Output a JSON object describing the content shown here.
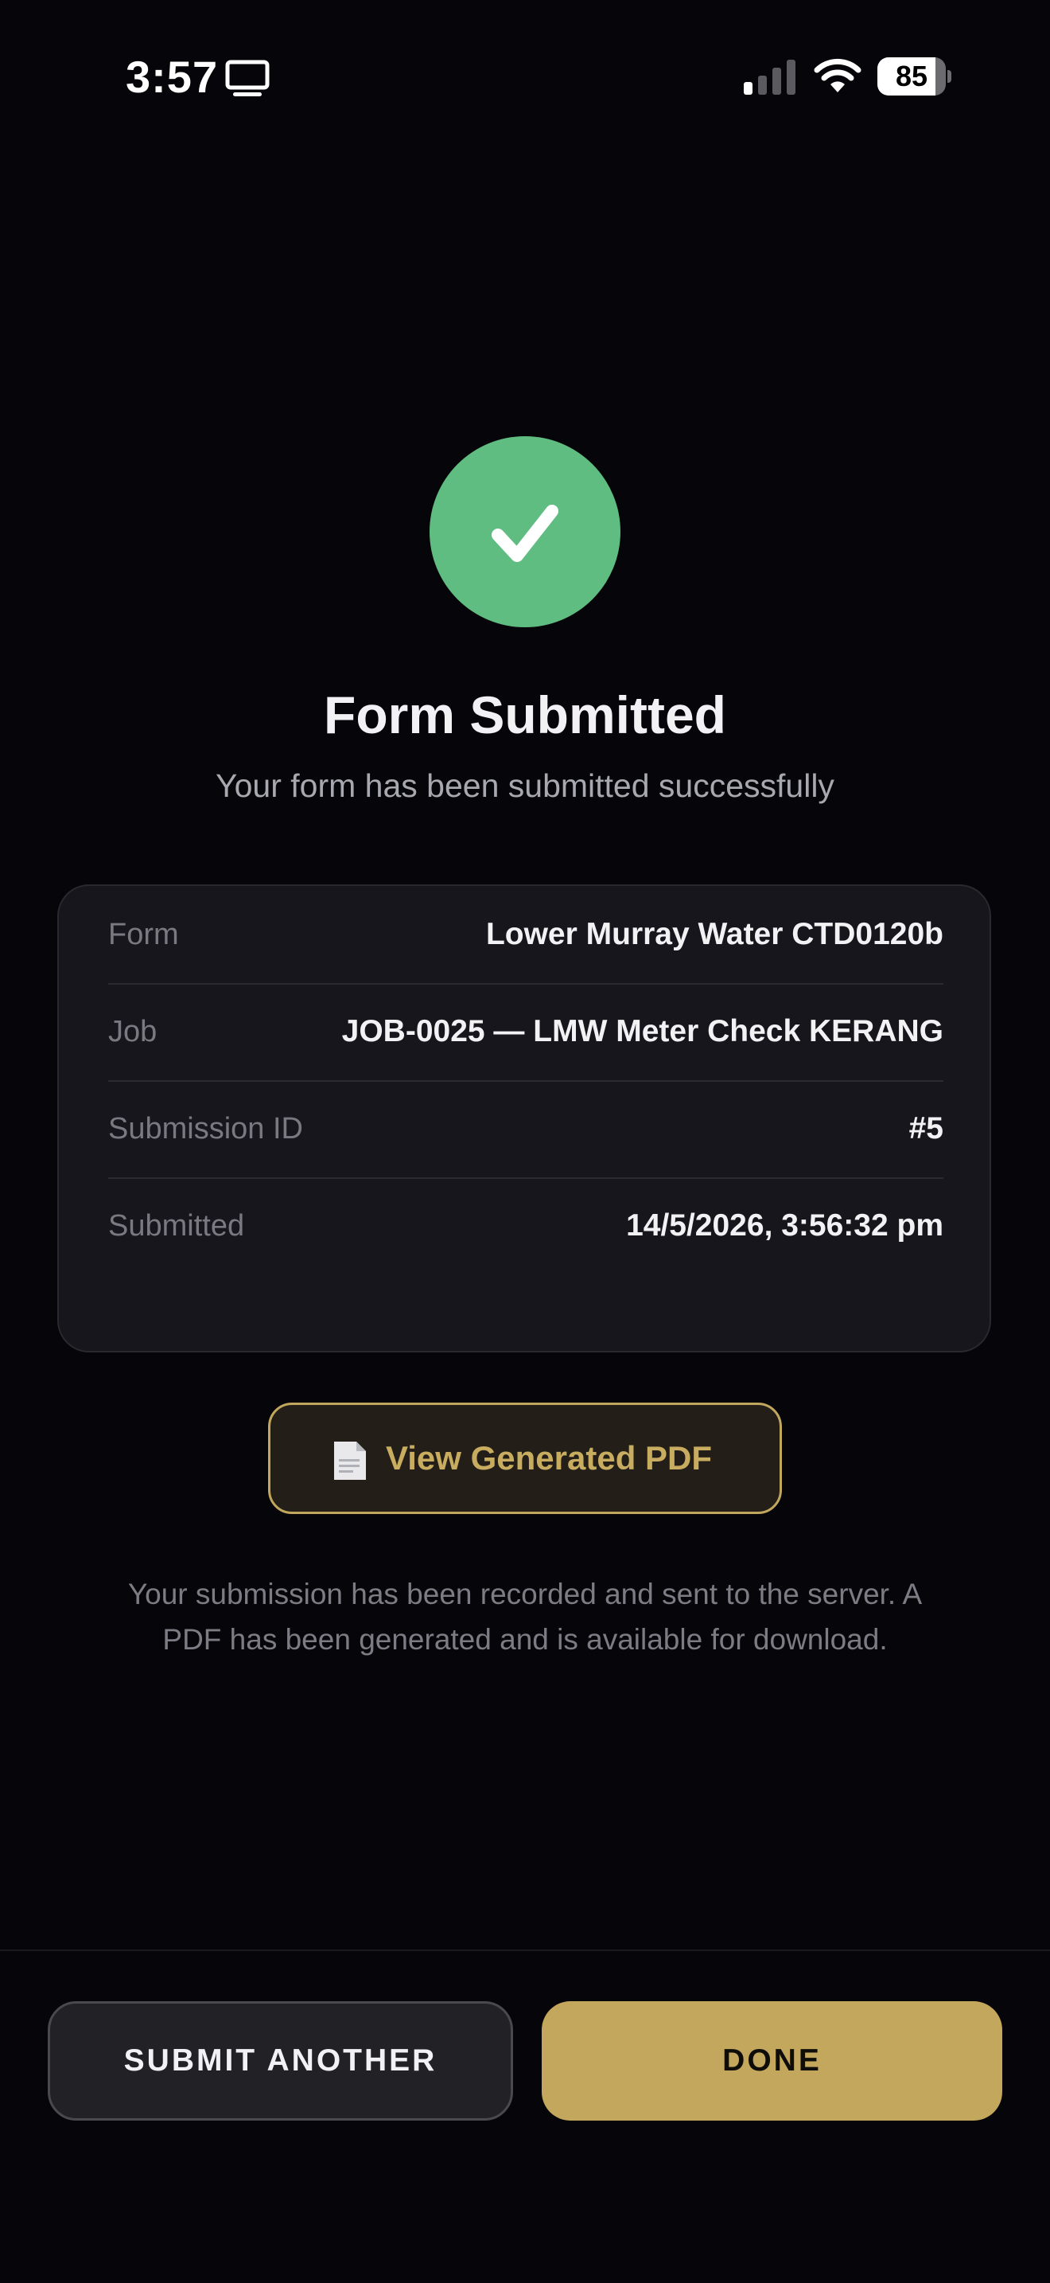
{
  "status_bar": {
    "time": "3:57",
    "screen_icon": "desktop-screen-icon",
    "signal_icon": "cellular-signal-icon",
    "wifi_icon": "wifi-icon",
    "battery_level": 85,
    "battery_label": "85"
  },
  "success": {
    "icon": "checkmark-icon",
    "icon_color": "#5fbd82",
    "title": "Form Submitted",
    "subtitle": "Your form has been submitted successfully"
  },
  "details": {
    "rows": [
      {
        "label": "Form",
        "value": "Lower Murray Water CTD0120b"
      },
      {
        "label": "Job",
        "value": "JOB-0025 — LMW Meter Check KERANG"
      },
      {
        "label": "Submission ID",
        "value": "#5"
      },
      {
        "label": "Submitted",
        "value": "14/5/2026, 3:56:32 pm"
      }
    ]
  },
  "pdf_button": {
    "icon": "document-icon",
    "label": "View Generated PDF",
    "accent_color": "#c1a75e"
  },
  "info_note": "Your submission has been recorded and sent to the server. A PDF has been generated and is available for download.",
  "actions": {
    "secondary_label": "SUBMIT ANOTHER",
    "primary_label": "DONE",
    "primary_color": "#c3a75c"
  }
}
